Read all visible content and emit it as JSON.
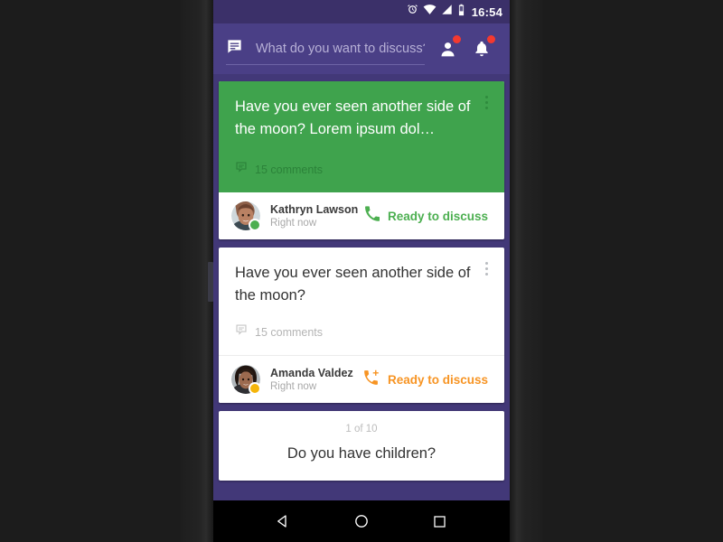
{
  "status_bar": {
    "time": "16:54",
    "icons": [
      "alarm-icon",
      "wifi-icon",
      "cellular-signal-icon",
      "battery-icon"
    ]
  },
  "toolbar": {
    "compose_icon": "chat-message-icon",
    "search_placeholder": "What do you want to discuss?",
    "search_value": "",
    "contacts_icon": "person-icon",
    "notifications_icon": "bell-icon",
    "badge_color": "#f4392f",
    "background": "#4a3f86"
  },
  "feed": {
    "cards": [
      {
        "id": "card-1",
        "accent": "green",
        "background": "#3fa34d",
        "title": "Have you ever seen another side of the moon? Lorem ipsum dol…",
        "comments": "15 comments",
        "comments_icon": "comment-bubble-icon",
        "overflow_icon": "overflow-menu-icon",
        "user": {
          "name": "Kathryn Lawson",
          "time": "Right now",
          "presence": "online",
          "presence_color": "#4caf50"
        },
        "action": {
          "label": "Ready to discuss",
          "icon": "phone-call-icon",
          "color": "#4caf50"
        }
      },
      {
        "id": "card-2",
        "accent": "white",
        "background": "#ffffff",
        "title": "Have you ever seen another side of the moon?",
        "comments": "15 comments",
        "comments_icon": "comment-bubble-icon",
        "overflow_icon": "overflow-menu-icon",
        "user": {
          "name": "Amanda Valdez",
          "time": "Right now",
          "presence": "away",
          "presence_color": "#f5b50a"
        },
        "action": {
          "label": "Ready to discuss",
          "icon": "phone-add-icon",
          "color": "#f79423"
        }
      },
      {
        "id": "card-3",
        "accent": "white",
        "background": "#ffffff",
        "pager": "1 of 10",
        "title": "Do you have children?"
      }
    ]
  },
  "nav_bar": {
    "back_label": "back-button",
    "home_label": "home-button",
    "recents_label": "recents-button"
  }
}
